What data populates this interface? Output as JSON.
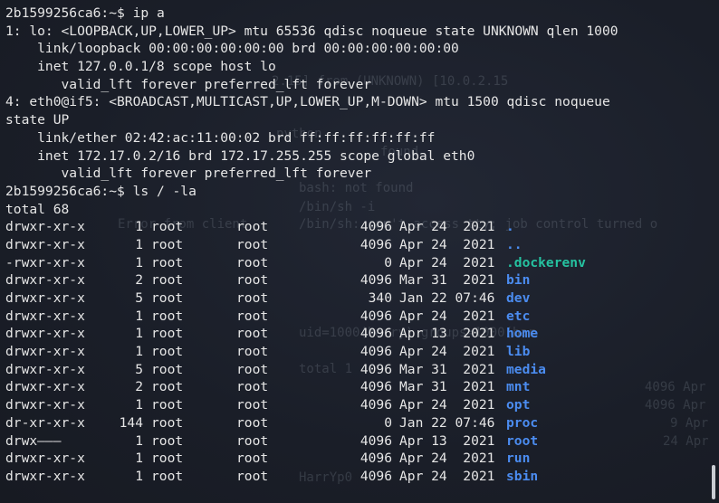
{
  "terminal": {
    "prompt": "2b1599256ca6:~$",
    "command_ip": "ip a",
    "command_ls": "ls / -la",
    "ip_output": [
      "1: lo: <LOOPBACK,UP,LOWER_UP> mtu 65536 qdisc noqueue state UNKNOWN qlen 1000",
      "    link/loopback 00:00:00:00:00:00 brd 00:00:00:00:00:00",
      "    inet 127.0.0.1/8 scope host lo",
      "       valid_lft forever preferred_lft forever",
      "4: eth0@if5: <BROADCAST,MULTICAST,UP,LOWER_UP,M-DOWN> mtu 1500 qdisc noqueue",
      "state UP",
      "    link/ether 02:42:ac:11:00:02 brd ff:ff:ff:ff:ff:ff",
      "    inet 172.17.0.2/16 brd 172.17.255.255 scope global eth0",
      "       valid_lft forever preferred_lft forever"
    ],
    "ls_total": "total 68",
    "ls_entries": [
      {
        "perm": "drwxr-xr-x",
        "links": "1",
        "user": "root",
        "group": "root",
        "size": "4096",
        "date": "Apr 24  2021",
        "name": ".",
        "kind": "dir"
      },
      {
        "perm": "drwxr-xr-x",
        "links": "1",
        "user": "root",
        "group": "root",
        "size": "4096",
        "date": "Apr 24  2021",
        "name": "..",
        "kind": "dir"
      },
      {
        "perm": "-rwxr-xr-x",
        "links": "1",
        "user": "root",
        "group": "root",
        "size": "0",
        "date": "Apr 24  2021",
        "name": ".dockerenv",
        "kind": "hidden"
      },
      {
        "perm": "drwxr-xr-x",
        "links": "2",
        "user": "root",
        "group": "root",
        "size": "4096",
        "date": "Mar 31  2021",
        "name": "bin",
        "kind": "dir"
      },
      {
        "perm": "drwxr-xr-x",
        "links": "5",
        "user": "root",
        "group": "root",
        "size": "340",
        "date": "Jan 22 07:46",
        "name": "dev",
        "kind": "dir"
      },
      {
        "perm": "drwxr-xr-x",
        "links": "1",
        "user": "root",
        "group": "root",
        "size": "4096",
        "date": "Apr 24  2021",
        "name": "etc",
        "kind": "dir"
      },
      {
        "perm": "drwxr-xr-x",
        "links": "1",
        "user": "root",
        "group": "root",
        "size": "4096",
        "date": "Apr 13  2021",
        "name": "home",
        "kind": "dir"
      },
      {
        "perm": "drwxr-xr-x",
        "links": "1",
        "user": "root",
        "group": "root",
        "size": "4096",
        "date": "Apr 24  2021",
        "name": "lib",
        "kind": "dir"
      },
      {
        "perm": "drwxr-xr-x",
        "links": "5",
        "user": "root",
        "group": "root",
        "size": "4096",
        "date": "Mar 31  2021",
        "name": "media",
        "kind": "dir"
      },
      {
        "perm": "drwxr-xr-x",
        "links": "2",
        "user": "root",
        "group": "root",
        "size": "4096",
        "date": "Mar 31  2021",
        "name": "mnt",
        "kind": "dir"
      },
      {
        "perm": "drwxr-xr-x",
        "links": "1",
        "user": "root",
        "group": "root",
        "size": "4096",
        "date": "Apr 24  2021",
        "name": "opt",
        "kind": "dir"
      },
      {
        "perm": "dr-xr-xr-x",
        "links": "144",
        "user": "root",
        "group": "root",
        "size": "0",
        "date": "Jan 22 07:46",
        "name": "proc",
        "kind": "dir"
      },
      {
        "perm": "drwx———",
        "links": "1",
        "user": "root",
        "group": "root",
        "size": "4096",
        "date": "Apr 13  2021",
        "name": "root",
        "kind": "dir"
      },
      {
        "perm": "drwxr-xr-x",
        "links": "1",
        "user": "root",
        "group": "root",
        "size": "4096",
        "date": "Apr 24  2021",
        "name": "run",
        "kind": "dir"
      },
      {
        "perm": "drwxr-xr-x",
        "links": "1",
        "user": "root",
        "group": "root",
        "size": "4096",
        "date": "Apr 24  2021",
        "name": "sbin",
        "kind": "dir"
      }
    ]
  },
  "colors": {
    "background": "#1b1f2a",
    "text": "#e6e6e6",
    "directory": "#4b8cf0",
    "hidden_file": "#25c2a0"
  },
  "ghost_text": [
    "2.15] from (UNKNOWN) [10.0.2.15",
    "python",
    "found",
    "bash: not found",
    "/bin/sh -i",
    "/bin/sh: can't access tty; job control turned o",
    "Error from client",
    "uid=1000(harry) groups=1000(har",
    "total 1",
    "4096 Apr",
    "4096 Apr",
    "9 Apr",
    "24 Apr",
    "HarrYp0"
  ]
}
